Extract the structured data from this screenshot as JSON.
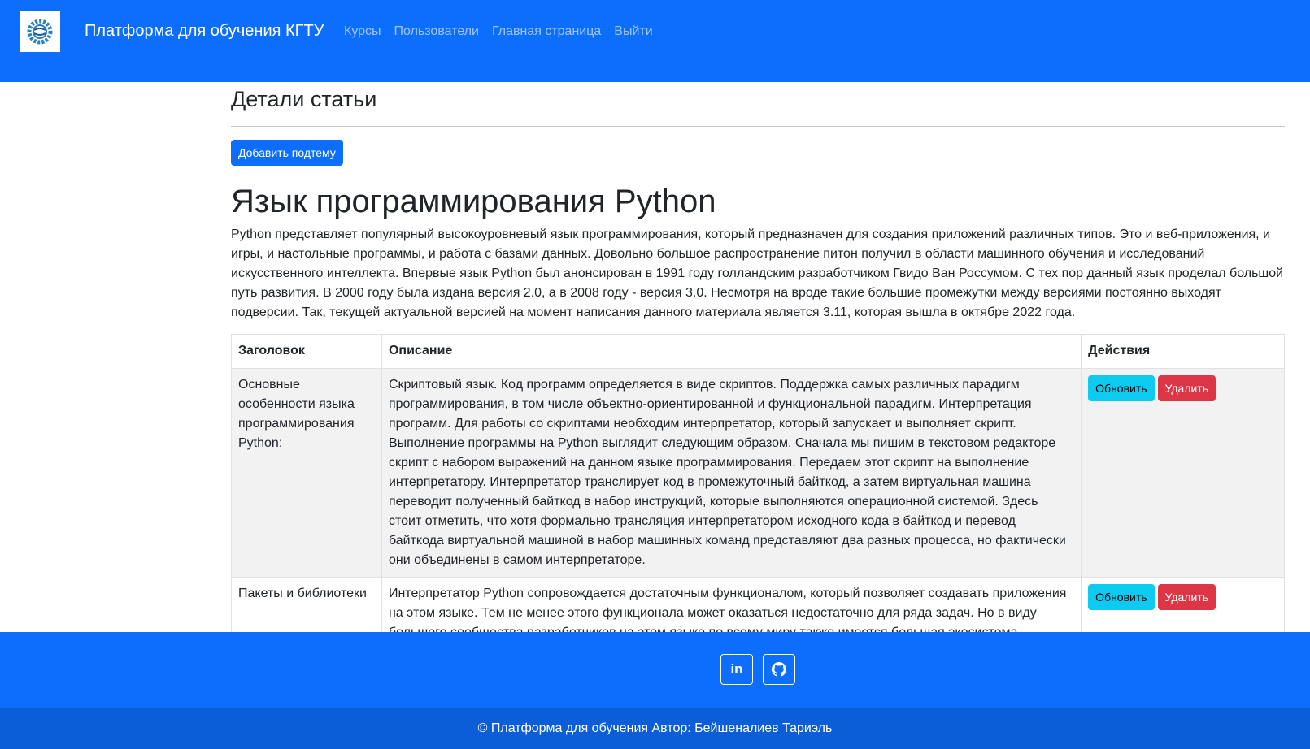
{
  "navbar": {
    "brand": "Платформа для обучения КГТУ",
    "links": [
      "Курсы",
      "Пользователи",
      "Главная страница",
      "Выйти"
    ],
    "logo_icon": "gear-logo-icon"
  },
  "page": {
    "heading": "Детали статьи",
    "add_button": "Добавить подтему"
  },
  "article": {
    "title": "Язык программирования Python",
    "text": "Python представляет популярный высокоуровневый язык программирования, который предназначен для создания приложений различных типов. Это и веб-приложения, и игры, и настольные программы, и работа с базами данных. Довольно большое распространение питон получил в области машинного обучения и исследований искусственного интеллекта. Впервые язык Python был анонсирован в 1991 году голландским разработчиком Гвидо Ван Россумом. С тех пор данный язык проделал большой путь развития. В 2000 году была издана версия 2.0, а в 2008 году - версия 3.0. Несмотря на вроде такие большие промежутки между версиями постоянно выходят подверсии. Так, текущей актуальной версией на момент написания данного материала является 3.11, которая вышла в октябре 2022 года."
  },
  "table": {
    "headers": [
      "Заголовок",
      "Описание",
      "Действия"
    ],
    "rows": [
      {
        "title": "Основные особенности языка программирования Python:",
        "description": "Скриптовый язык. Код программ определяется в виде скриптов. Поддержка самых различных парадигм программирования, в том числе объектно-ориентированной и функциональной парадигм. Интерпретация программ. Для работы со скриптами необходим интерпретатор, который запускает и выполняет скрипт. Выполнение программы на Python выглядит следующим образом. Сначала мы пишим в текстовом редакторе скрипт с набором выражений на данном языке программирования. Передаем этот скрипт на выполнение интерпретатору. Интерпретатор транслирует код в промежуточный байткод, а затем виртуальная машина переводит полученный байткод в набор инструкций, которые выполняются операционной системой. Здесь стоит отметить, что хотя формально трансляция интерпретатором исходного кода в байткод и перевод байткода виртуальной машиной в набор машинных команд представляют два разных процесса, но фактически они объединены в самом интерпретаторе.",
        "update": "Обновить",
        "delete": "Удалить"
      },
      {
        "title": "Пакеты и библиотеки",
        "description": "Интерпретатор Python сопровождается достаточным функционалом, который позволяет создавать приложения на этом языке. Тем не менее этого функционала может оказаться недостаточно для ряда задач. Но в виду большого сообщества разработчиков на этом языке по всему миру также имеется большая экосистема",
        "update": "Обновить",
        "delete": "Удалить"
      }
    ]
  },
  "footer": {
    "social": [
      "linkedin-icon",
      "github-icon"
    ],
    "linkedin_text": "in",
    "copyright": "© Платформа для обучения Автор: Бейшеналиев Тариэль"
  },
  "colors": {
    "primary": "#0d6efd",
    "footer_bottom": "#0b5ed7",
    "info": "#0dcaf0",
    "danger": "#dc3545"
  }
}
